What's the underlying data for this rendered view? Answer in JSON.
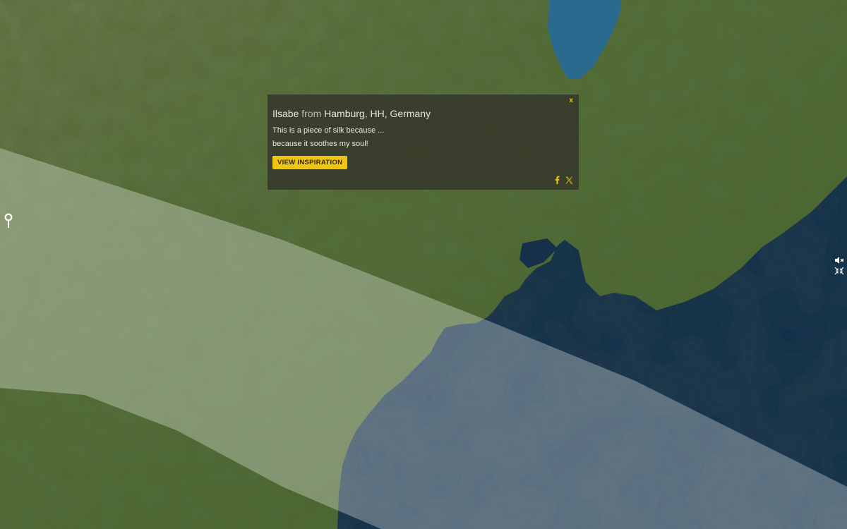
{
  "colors": {
    "accent": "#f1c40f",
    "popup_background": "rgba(52,55,42,0.84)",
    "land": "#51683a",
    "sea": "#17324a",
    "lake": "#2a6a8e",
    "band_overlay": "rgba(255,255,255,0.3)"
  },
  "popup": {
    "name": "Ilsabe",
    "from_word": "from",
    "location": "Hamburg, HH, Germany",
    "line1": "This is a piece of silk because ...",
    "line2": "because it soothes my soul!",
    "button_label": "VIEW INSPIRATION",
    "close_label": "x",
    "share_icons": [
      "facebook-icon",
      "x-icon"
    ]
  },
  "controls": {
    "pin_icon": "location-pin-icon",
    "mute_icon": "speaker-mute-icon",
    "collapse_icon": "collapse-arrows-icon"
  }
}
